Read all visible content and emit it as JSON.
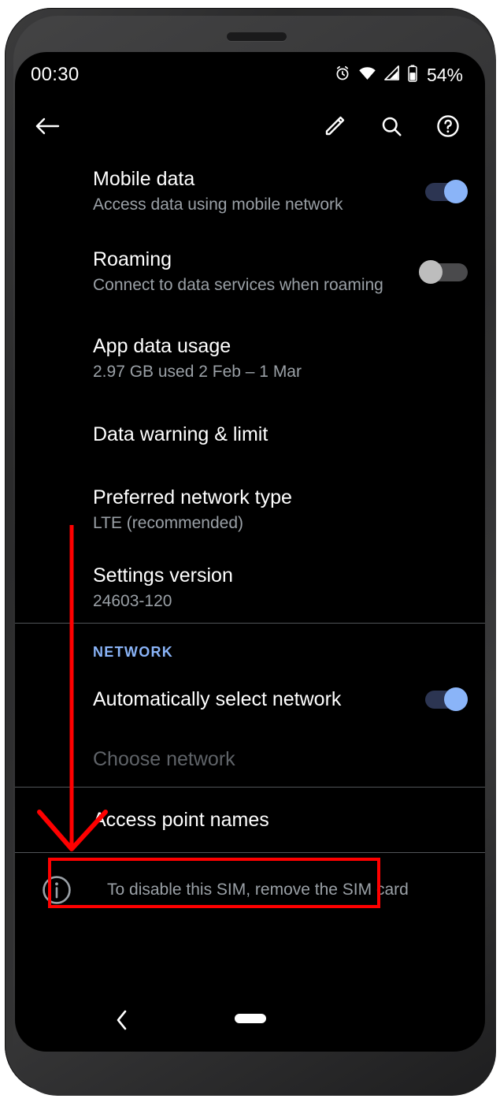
{
  "status_bar": {
    "time": "00:30",
    "battery_text": "54%",
    "icons": [
      "alarm-icon",
      "wifi-icon",
      "cellular-signal-icon",
      "battery-icon"
    ]
  },
  "action_bar": {
    "back_label": "back-arrow-icon",
    "edit_label": "edit-pencil-icon",
    "search_label": "search-icon",
    "help_label": "help-circle-icon"
  },
  "list": {
    "items": [
      {
        "title": "Mobile data",
        "summary": "Access data using mobile network",
        "toggle": "on"
      },
      {
        "title": "Roaming",
        "summary": "Connect to data services when roaming",
        "toggle": "off"
      },
      {
        "title": "App data usage",
        "summary": "2.97 GB used 2 Feb – 1 Mar"
      },
      {
        "title": "Data warning & limit",
        "summary": ""
      },
      {
        "title": "Preferred network type",
        "summary": "LTE (recommended)"
      },
      {
        "title": "Settings version",
        "summary": "24603-120"
      }
    ]
  },
  "network_section": {
    "header": "NETWORK",
    "header_color": "#8ab4f8",
    "auto_select": {
      "title": "Automatically select network",
      "toggle": "on"
    },
    "choose_network": {
      "title": "Choose network",
      "state": "disabled"
    }
  },
  "apn_item": {
    "title": "Access point names"
  },
  "sim_note": {
    "icon": "info-icon",
    "text": "To disable this SIM, remove the SIM card"
  },
  "nav_bar": {
    "back": "nav-back-chevron-icon",
    "home": "nav-home-pill"
  },
  "annotation": {
    "arrow_color": "#fe0000",
    "highlight_color": "#fe0000"
  }
}
